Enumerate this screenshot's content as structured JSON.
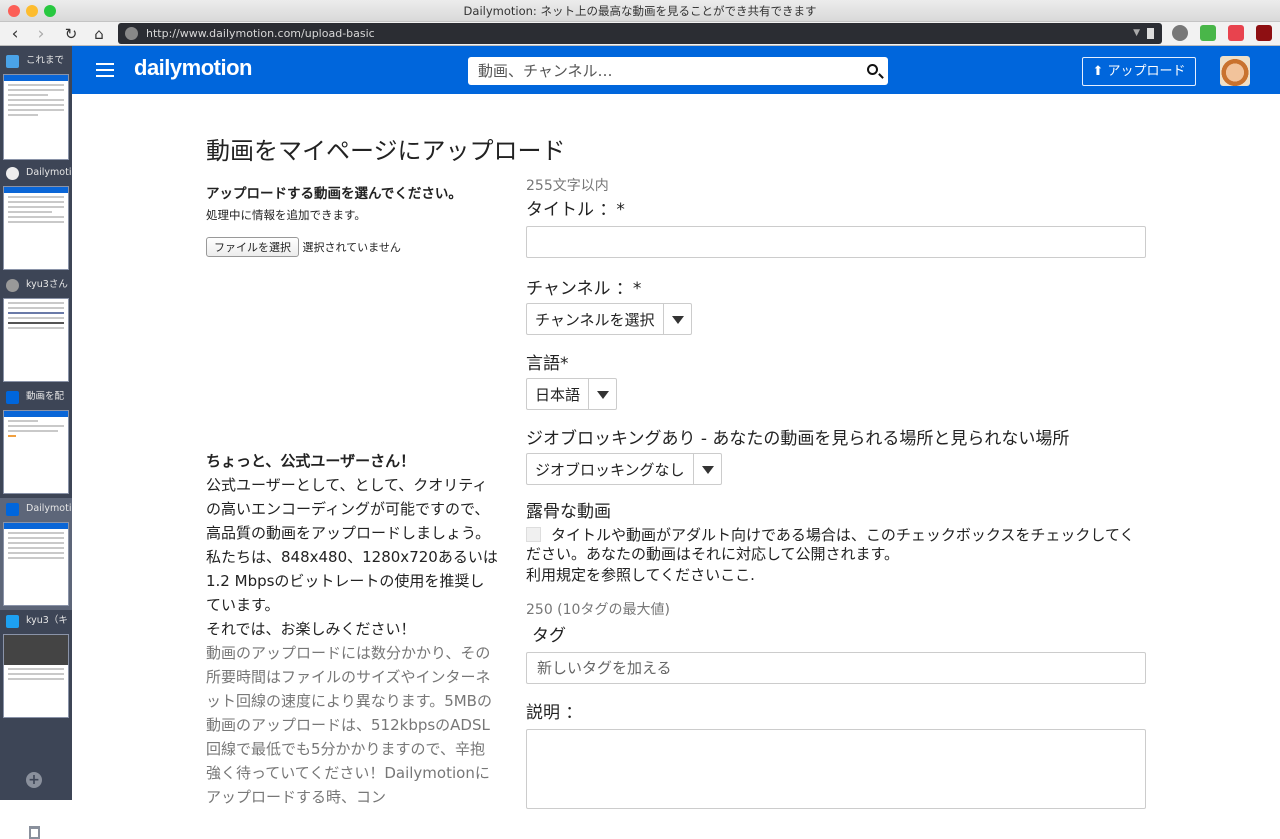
{
  "window": {
    "title": "Dailymotion: ネット上の最高な動画を見ることができ共有できます"
  },
  "browser": {
    "url": "http://www.dailymotion.com/upload-basic"
  },
  "sidebar": {
    "tabs": [
      {
        "label": "これまで"
      },
      {
        "label": "Dailymotion"
      },
      {
        "label": "kyu3さん"
      },
      {
        "label": "動画を配"
      },
      {
        "label": "Dailymotion"
      },
      {
        "label": "kyu3（キ"
      }
    ]
  },
  "header": {
    "logo": "dailymotion",
    "search_placeholder": "動画、チャンネル…",
    "upload_label": "アップロード"
  },
  "page": {
    "title": "動画をマイページにアップロード"
  },
  "file_section": {
    "heading": "アップロードする動画を選んでください。",
    "subtext": "処理中に情報を追加できます。",
    "button_label": "ファイルを選択",
    "status": "選択されていません"
  },
  "official": {
    "heading": "ちょっと、公式ユーザーさん！",
    "paragraph": "公式ユーザーとして、として、クオリティの高いエンコーディングが可能ですので、高品質の動画をアップロードしましょう。私たちは、848x480、1280x720あるいは1.2 Mbpsのビットレートの使用を推奨しています。",
    "closing": "それでは、お楽しみください！",
    "note": "動画のアップロードには数分かかり、その所要時間はファイルのサイズやインターネット回線の速度により異なります。5MBの動画のアップロードは、512kbpsのADSL回線で最低でも5分かかりますので、辛抱強く待っていてください！Dailymotionにアップロードする時、コン"
  },
  "form": {
    "title_hint": "255文字以内",
    "title_label": "タイトル ：*",
    "channel_label": "チャンネル ：*",
    "channel_value": "チャンネルを選択",
    "language_label": "言語*",
    "language_value": "日本語",
    "geo_label": "ジオブロッキングあり - あなたの動画を見られる場所と見られない場所",
    "geo_value": "ジオブロッキングなし",
    "explicit_label": "露骨な動画",
    "explicit_text": "タイトルや動画がアダルト向けである場合は、このチェックボックスをチェックしてください。あなたの動画はそれに対応して公開されます。",
    "terms_text": "利用規定を参照してくださいここ.",
    "tags_hint": "250 (10タグの最大値)",
    "tags_label": "タグ",
    "tags_placeholder": "新しいタグを加える",
    "description_label": "説明 ："
  },
  "colors": {
    "brand": "#0066dc",
    "sidebar": "#3d4556"
  }
}
